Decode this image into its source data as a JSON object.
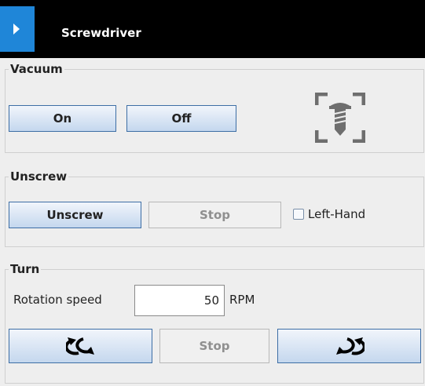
{
  "titlebar": {
    "title": "Screwdriver",
    "toggle_icon": "chevron-right-icon",
    "accent_color": "#1f86d8"
  },
  "vacuum": {
    "legend": "Vacuum",
    "on_label": "On",
    "off_label": "Off",
    "status_icon": "screw-target-icon"
  },
  "unscrew": {
    "legend": "Unscrew",
    "unscrew_label": "Unscrew",
    "stop_label": "Stop",
    "left_hand_label": "Left-Hand",
    "left_hand_checked": false
  },
  "turn": {
    "legend": "Turn",
    "rotation_speed_label": "Rotation speed",
    "rotation_speed_value": "50",
    "unit_label": "RPM",
    "rotate_ccw_icon": "rotate-counterclockwise-icon",
    "stop_label": "Stop",
    "rotate_cw_icon": "rotate-clockwise-icon"
  }
}
